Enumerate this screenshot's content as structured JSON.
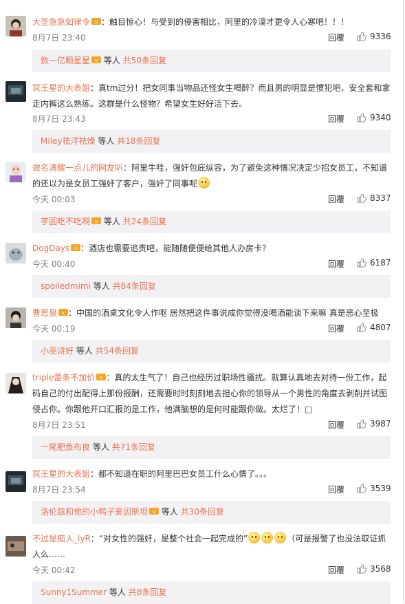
{
  "comments": [
    {
      "username": "大圣急急如律令",
      "text": "：触目惊心！与受到的侵害相比，阿里的冷漠才更令人心寒吧！！！",
      "time": "8月7日 23:40",
      "reply_label": "回覆",
      "likes": "9336",
      "sub": {
        "username": "数一亿颗星星",
        "vip": true,
        "mid": "等人",
        "count": "共50条回复"
      }
    },
    {
      "username": "冥王星的大表姐",
      "text": "：真tm过分！把女同事当物品还怪女生喝醉？而且男的明显是惯犯吧，安全套和拿走内裤这么熟练。这群是什么怪物？希望女生好好活下去。",
      "time": "8月7日 23:43",
      "reply_label": "回覆",
      "likes": "9340",
      "sub": {
        "username": "Miley祛浮祛燥",
        "vip": false,
        "mid": "等人",
        "count": "共18条回复"
      }
    },
    {
      "username": "做名清醒一点儿的网友叭",
      "text": "：阿里牛哇，强奸包庇纵容，为了避免这种情况决定少招女员工，不知道的还以为是女员工强奸了客户，强奸了同事呢",
      "time": "今天 00:03",
      "reply_label": "回覆",
      "likes": "8337",
      "sub": {
        "username": "芋圆吃不吃啊",
        "vip": true,
        "mid": "等人",
        "count": "共24条回复"
      }
    },
    {
      "username": "DogDays",
      "text": "：酒店也需要追责吧，能随随便便给其他人办房卡？",
      "time": "今天 00:40",
      "reply_label": "回覆",
      "likes": "6187",
      "sub": {
        "username": "spoiledmimi",
        "vip": false,
        "mid": "等人",
        "count": "共84条回复"
      }
    },
    {
      "username": "曹思泉",
      "text": "：中国的酒桌文化令人作呕 居然把这件事说成你觉得没喝酒能谈下来嘛 真是恶心至极",
      "time": "今天 00:19",
      "reply_label": "回覆",
      "likes": "4807",
      "sub": {
        "username": "小巫诗好",
        "vip": false,
        "mid": "等人",
        "count": "共54条回复"
      }
    },
    {
      "username": "triple蕾条不加价",
      "text": "：真的太生气了！自己也经历过职场性骚扰。就算认真地去对待一份工作，起码自己的付出配得上那份报酬，还需要时时刻刻地去担心你的领导从一个男性的角度去剥削并试图侵占你。你跟他开口汇报的是工作，他满脑想的是何时能跟你做。太烂了！□",
      "time": "8月7日 23:51",
      "reply_label": "回覆",
      "likes": "3987",
      "sub": {
        "username": "一尾肥鱼布良",
        "vip": false,
        "mid": "等人",
        "count": "共71条回复"
      }
    },
    {
      "username": "冥王星的大表姐",
      "text": "：都不知道在职的阿里巴巴女员工什么心情了。。。",
      "time": "8月7日 23:54",
      "reply_label": "回覆",
      "likes": "3539",
      "sub": {
        "username": "洛伦兹和他的小鸭子爱因斯坦",
        "vip": true,
        "mid": "等人",
        "count": "共30条回复"
      }
    },
    {
      "username": "不过是痴人_lyR",
      "text": "：“对女性的强奸，是整个社会一起完成的”",
      "text2": "（可是报警了也没法取证抓人么……",
      "time": "今天 00:42",
      "reply_label": "回覆",
      "likes": "3568",
      "sub": {
        "username": "Sunny1Summer",
        "vip": false,
        "mid": "等人",
        "count": "共8条回复"
      }
    }
  ]
}
